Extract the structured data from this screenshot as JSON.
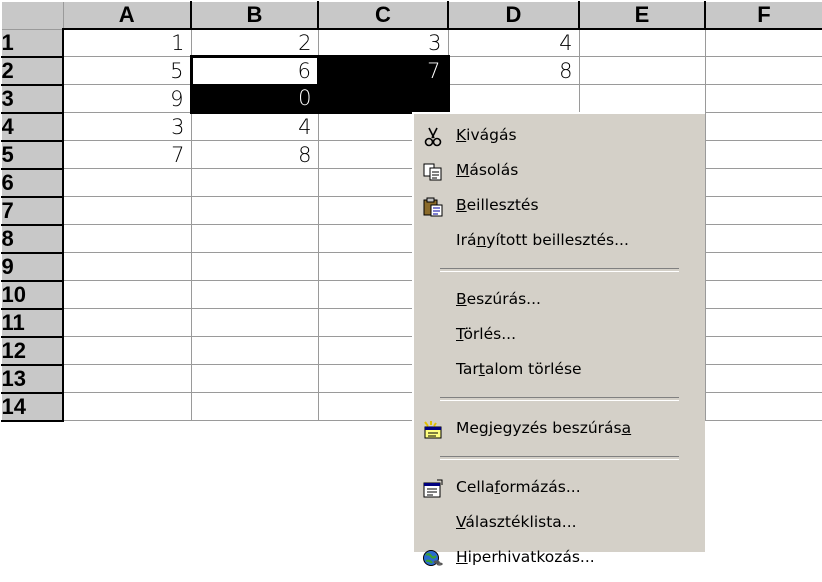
{
  "columns": [
    "A",
    "B",
    "C",
    "D",
    "E",
    "F"
  ],
  "rows": [
    {
      "num": "1",
      "cells": [
        "1",
        "2",
        "3",
        "4",
        "",
        ""
      ]
    },
    {
      "num": "2",
      "cells": [
        "5",
        "6",
        "7",
        "8",
        "",
        ""
      ]
    },
    {
      "num": "3",
      "cells": [
        "9",
        "0",
        "",
        "",
        "",
        ""
      ]
    },
    {
      "num": "4",
      "cells": [
        "3",
        "4",
        "",
        "",
        "",
        ""
      ]
    },
    {
      "num": "5",
      "cells": [
        "7",
        "8",
        "",
        "",
        "",
        ""
      ]
    },
    {
      "num": "6",
      "cells": [
        "",
        "",
        "",
        "",
        "",
        ""
      ]
    },
    {
      "num": "7",
      "cells": [
        "",
        "",
        "",
        "",
        "",
        ""
      ]
    },
    {
      "num": "8",
      "cells": [
        "",
        "",
        "",
        "",
        "",
        ""
      ]
    },
    {
      "num": "9",
      "cells": [
        "",
        "",
        "",
        "",
        "",
        ""
      ]
    },
    {
      "num": "10",
      "cells": [
        "",
        "",
        "",
        "",
        "",
        ""
      ]
    },
    {
      "num": "11",
      "cells": [
        "",
        "",
        "",
        "",
        "",
        ""
      ]
    },
    {
      "num": "12",
      "cells": [
        "",
        "",
        "",
        "",
        "",
        ""
      ]
    },
    {
      "num": "13",
      "cells": [
        "",
        "",
        "",
        "",
        "",
        ""
      ]
    },
    {
      "num": "14",
      "cells": [
        "",
        "",
        "",
        "",
        "",
        ""
      ]
    }
  ],
  "selection": {
    "active_cell": "B2",
    "range": "B2:C3"
  },
  "context_menu": {
    "items": [
      {
        "pre": "",
        "ul": "K",
        "post": "ivágás",
        "icon": "scissors-icon"
      },
      {
        "pre": "",
        "ul": "M",
        "post": "ásolás",
        "icon": "copy-icon"
      },
      {
        "pre": "",
        "ul": "B",
        "post": "eillesztés",
        "icon": "paste-icon"
      },
      {
        "pre": "Irá",
        "ul": "n",
        "post": "yított beillesztés...",
        "icon": ""
      },
      {
        "separator": true
      },
      {
        "pre": "",
        "ul": "B",
        "post": "eszúrás...",
        "icon": ""
      },
      {
        "pre": "",
        "ul": "T",
        "post": "örlés...",
        "icon": ""
      },
      {
        "pre": "Tar",
        "ul": "t",
        "post": "alom törlése",
        "icon": ""
      },
      {
        "separator": true
      },
      {
        "pre": "Megjegyzés beszúrás",
        "ul": "a",
        "post": "",
        "icon": "insert-comment-icon"
      },
      {
        "separator": true
      },
      {
        "pre": "Cella",
        "ul": "f",
        "post": "ormázás...",
        "icon": "format-cells-icon"
      },
      {
        "pre": "",
        "ul": "V",
        "post": "álasztéklista...",
        "icon": ""
      },
      {
        "pre": "",
        "ul": "H",
        "post": "iperhivatkozás...",
        "icon": "hyperlink-icon"
      }
    ]
  },
  "colors": {
    "header_bg": "#c8c8c8",
    "menu_bg": "#d4d0c8",
    "selection_fill": "#000000"
  }
}
